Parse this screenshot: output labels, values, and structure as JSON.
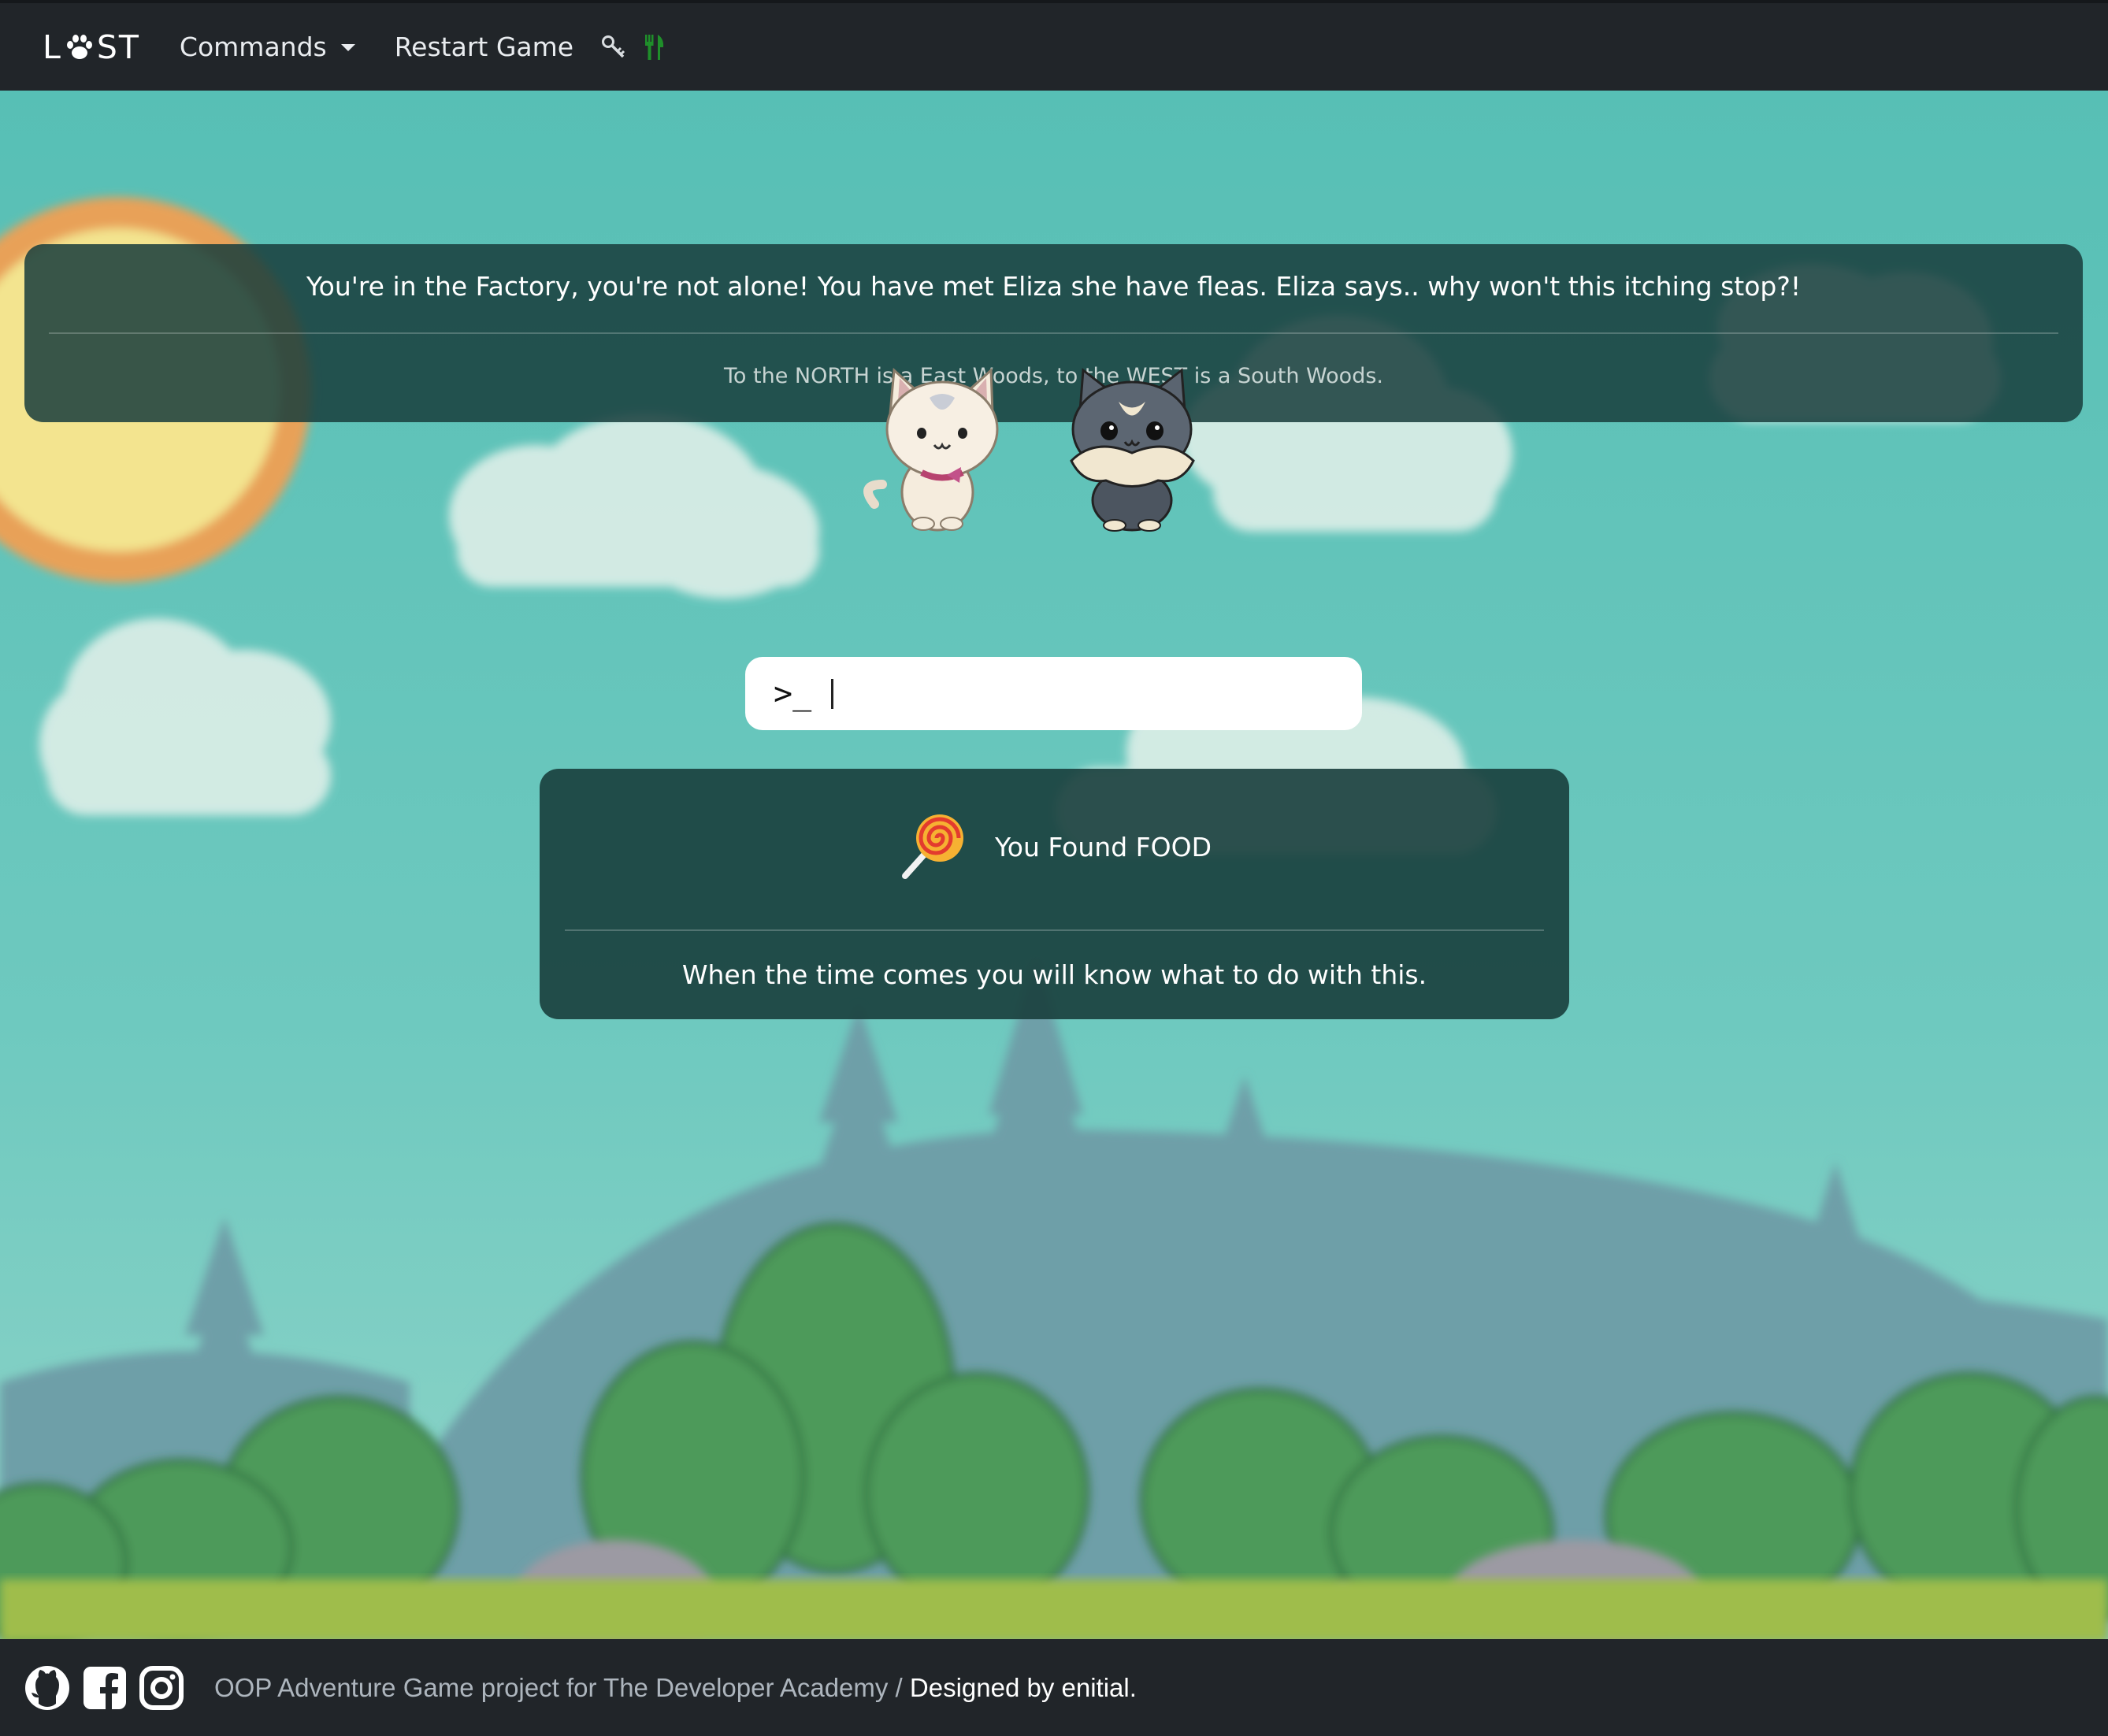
{
  "navbar": {
    "brand_left": "L",
    "brand_right": "ST",
    "brand_icon": "paw-icon",
    "commands_label": "Commands",
    "restart_label": "Restart Game",
    "inventory_icons": [
      "key-icon",
      "fork-knife-icon"
    ],
    "food_icon_color": "#1f8f2a"
  },
  "location": {
    "message": "You're in the Factory, you're not alone! You have met Eliza she have fleas. Eliza says.. why won't this itching stop?!",
    "exits": "To the NORTH is a East Woods, to the WEST is a South Woods."
  },
  "characters": [
    {
      "role": "player",
      "icon": "white-cat-icon"
    },
    {
      "role": "npc",
      "icon": "grey-fluffy-cat-icon"
    }
  ],
  "command": {
    "prompt": ">_",
    "value": "",
    "placeholder": ""
  },
  "found": {
    "icon": "lollipop-icon",
    "title": "You Found FOOD",
    "description": "When the time comes you will know what to do with this."
  },
  "footer": {
    "icons": [
      "github-icon",
      "facebook-icon",
      "instagram-icon"
    ],
    "text": "OOP Adventure Game project for The Developer Academy / ",
    "designer": "Designed by enitial."
  },
  "colors": {
    "navbar_bg": "#212529",
    "sky": "#5bc0b6",
    "panel": "#183e3c"
  }
}
